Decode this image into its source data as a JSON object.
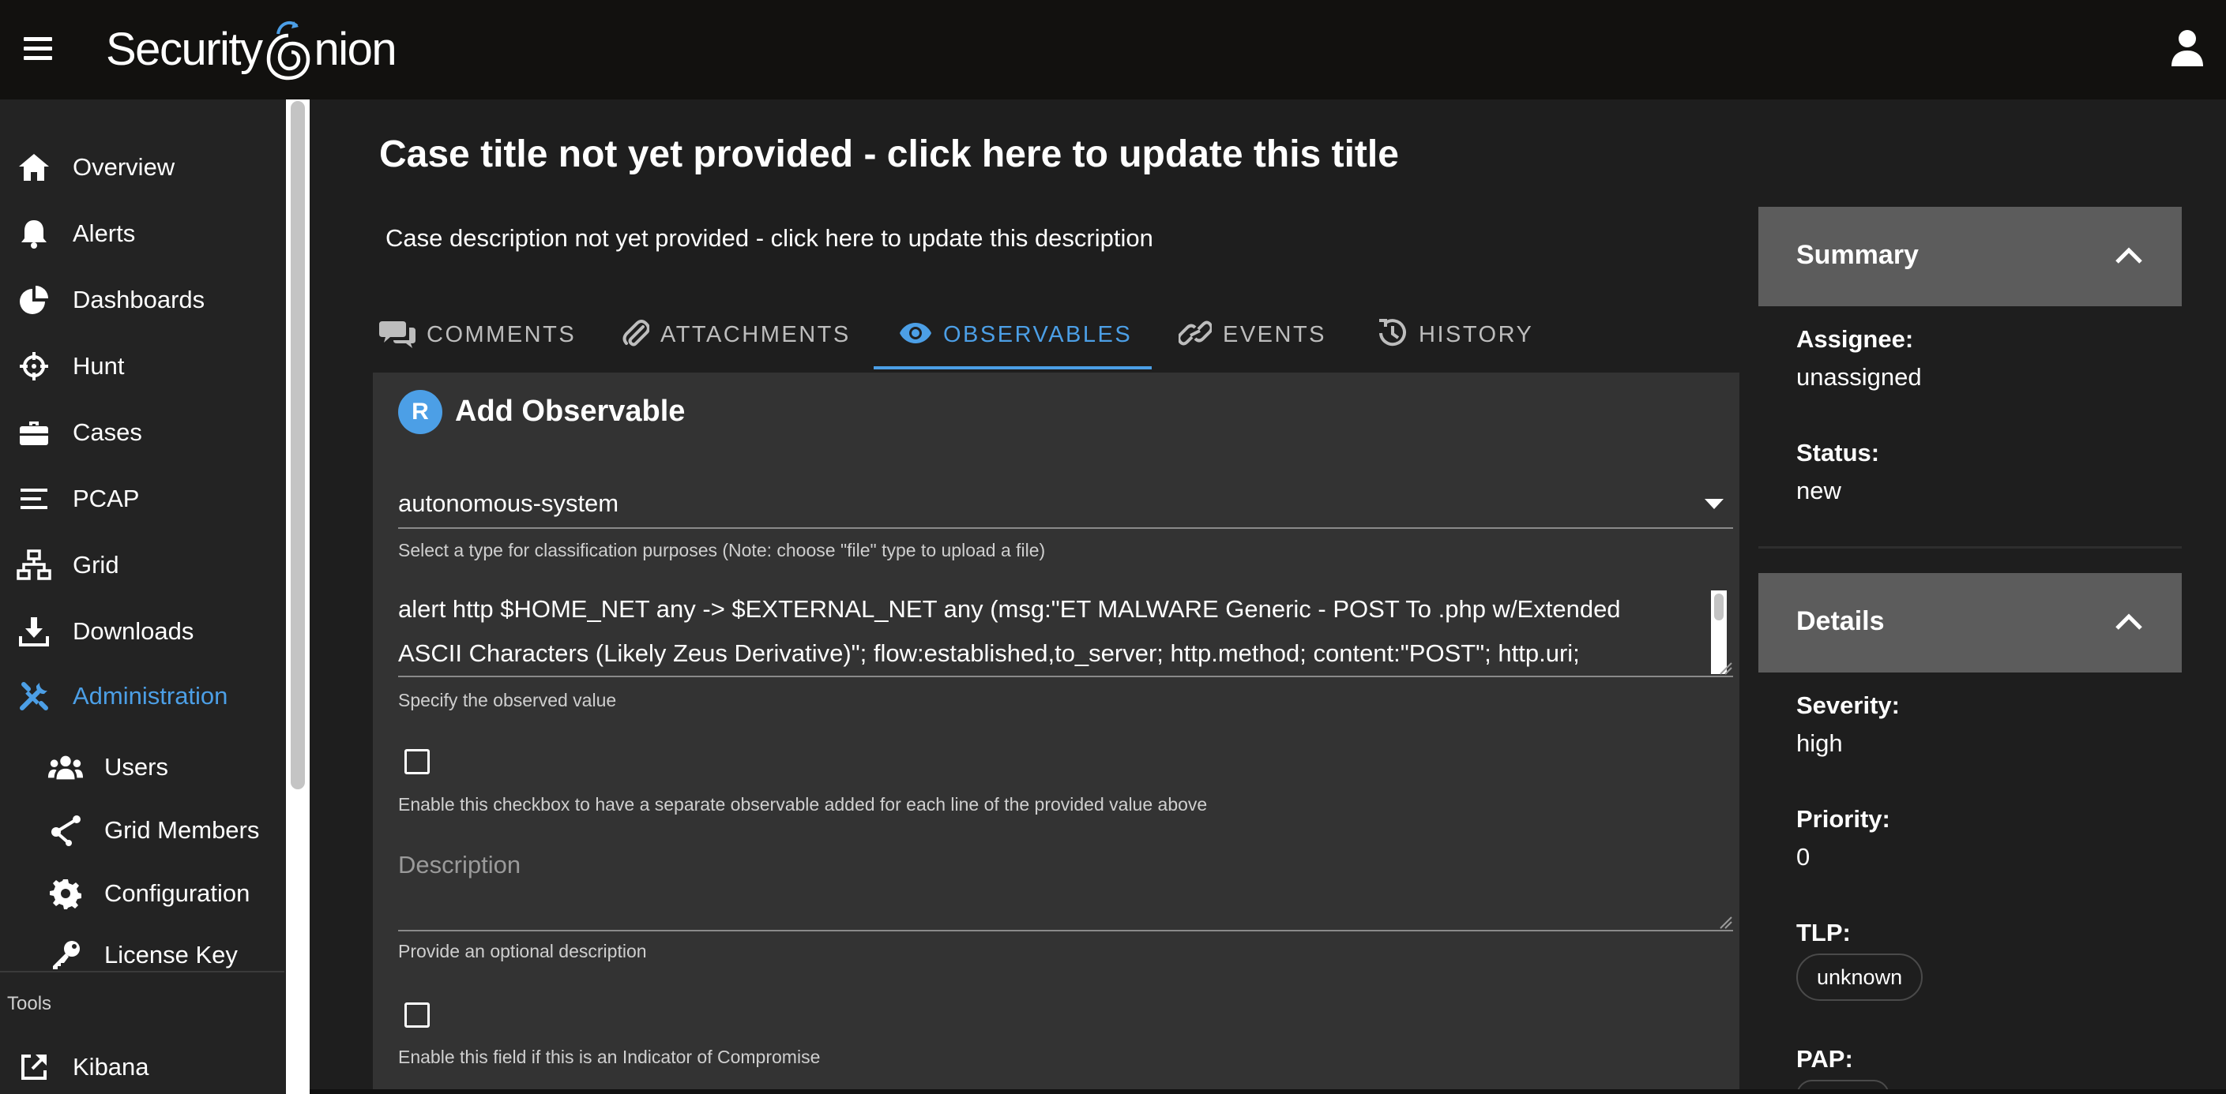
{
  "app": {
    "logo_text_left": "Security",
    "logo_text_right": "nion"
  },
  "sidebar": {
    "items": [
      {
        "label": "Overview",
        "icon": "home-icon"
      },
      {
        "label": "Alerts",
        "icon": "bell-icon"
      },
      {
        "label": "Dashboards",
        "icon": "pie-chart-icon"
      },
      {
        "label": "Hunt",
        "icon": "crosshair-icon"
      },
      {
        "label": "Cases",
        "icon": "briefcase-icon"
      },
      {
        "label": "PCAP",
        "icon": "lines-icon"
      },
      {
        "label": "Grid",
        "icon": "network-icon"
      },
      {
        "label": "Downloads",
        "icon": "download-icon"
      },
      {
        "label": "Administration",
        "icon": "tools-icon",
        "active": true
      }
    ],
    "sub_items": [
      {
        "label": "Users",
        "icon": "users-icon"
      },
      {
        "label": "Grid Members",
        "icon": "grid-members-icon"
      },
      {
        "label": "Configuration",
        "icon": "gear-icon"
      },
      {
        "label": "License Key",
        "icon": "key-icon"
      }
    ],
    "tools_label": "Tools",
    "tools": [
      {
        "label": "Kibana",
        "icon": "external-link-icon"
      }
    ]
  },
  "case": {
    "title": "Case title not yet provided - click here to update this title",
    "description": "Case description not yet provided - click here to update this description"
  },
  "tabs": [
    {
      "label": "COMMENTS",
      "icon": "comments-icon"
    },
    {
      "label": "ATTACHMENTS",
      "icon": "paperclip-icon"
    },
    {
      "label": "OBSERVABLES",
      "icon": "eye-icon",
      "active": true
    },
    {
      "label": "EVENTS",
      "icon": "link-icon"
    },
    {
      "label": "HISTORY",
      "icon": "history-icon"
    }
  ],
  "observable_form": {
    "avatar_letter": "R",
    "title": "Add Observable",
    "type_value": "autonomous-system",
    "type_hint": "Select a type for classification purposes (Note: choose \"file\" type to upload a file)",
    "value_line1": "alert http $HOME_NET any -> $EXTERNAL_NET any (msg:\"ET MALWARE Generic - POST To .php w/Extended",
    "value_line2": "ASCII Characters (Likely Zeus Derivative)\"; flow:established,to_server; http.method; content:\"POST\"; http.uri;",
    "value_hint": "Specify the observed value",
    "multiline_hint": "Enable this checkbox to have a separate observable added for each line of the provided value above",
    "description_placeholder": "Description",
    "description_hint": "Provide an optional description",
    "ioc_hint": "Enable this field if this is an Indicator of Compromise"
  },
  "summary": {
    "title": "Summary",
    "assignee_label": "Assignee:",
    "assignee_value": "unassigned",
    "status_label": "Status:",
    "status_value": "new"
  },
  "details": {
    "title": "Details",
    "severity_label": "Severity:",
    "severity_value": "high",
    "priority_label": "Priority:",
    "priority_value": "0",
    "tlp_label": "TLP:",
    "tlp_value": "unknown",
    "pap_label": "PAP:"
  },
  "colors": {
    "accent": "#4c9fe6",
    "topbar": "#12110f",
    "panel": "#333333",
    "card_header": "#5c5c5c"
  }
}
